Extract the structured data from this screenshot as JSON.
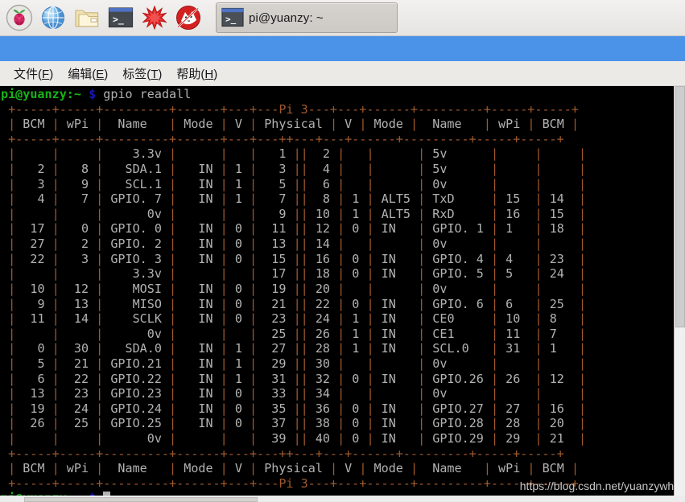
{
  "taskbar": {
    "icons": [
      {
        "name": "raspberry-menu-icon",
        "label": "Raspberry Pi Menu"
      },
      {
        "name": "globe-browser-icon",
        "label": "Web Browser"
      },
      {
        "name": "file-manager-icon",
        "label": "File Manager"
      },
      {
        "name": "terminal-icon",
        "label": "Terminal"
      },
      {
        "name": "mathematica-icon",
        "label": "Mathematica"
      },
      {
        "name": "wolfram-icon",
        "label": "Wolfram"
      }
    ],
    "task_button_label": "pi@yuanzy: ~"
  },
  "window": {
    "title": "pi@yuanzy: ~"
  },
  "menubar": {
    "items": [
      {
        "text": "文件",
        "accel": "F"
      },
      {
        "text": "编辑",
        "accel": "E"
      },
      {
        "text": "标签",
        "accel": "T"
      },
      {
        "text": "帮助",
        "accel": "H"
      }
    ]
  },
  "terminal": {
    "prompt_user": "pi@yuanzy",
    "prompt_path": ":~",
    "prompt_symbol": "$",
    "command": "gpio readall",
    "watermark": "https://blog.csdn.net/yuanzywhu",
    "board": "Pi 3",
    "colors": {
      "background": "#000000",
      "foreground": "#b2b2b2",
      "green": "#18b218",
      "blue": "#1818b2",
      "border": "#a05a2c"
    },
    "border_line": "+-----+-----+---------+------+---+---Pi 3---+---+------+---------+-----+-----+",
    "separator_line": "+-----+-----+---------+------+---+---++---+---+------+---------+-----+-----+",
    "header_line": "| BCM | wPi |   Name  | Mode | V | Physical | V | Mode | Name    | wPi | BCM |",
    "columns": [
      "BCM",
      "wPi",
      "Name",
      "Mode",
      "V",
      "Physical",
      "V",
      "Mode",
      "Name",
      "wPi",
      "BCM"
    ],
    "rows": [
      {
        "bcm_l": "",
        "wpi_l": "",
        "name_l": "3.3v",
        "mode_l": "",
        "v_l": "",
        "phys_l": "1",
        "phys_r": "2",
        "v_r": "",
        "mode_r": "",
        "name_r": "5v",
        "wpi_r": "",
        "bcm_r": ""
      },
      {
        "bcm_l": "2",
        "wpi_l": "8",
        "name_l": "SDA.1",
        "mode_l": "IN",
        "v_l": "1",
        "phys_l": "3",
        "phys_r": "4",
        "v_r": "",
        "mode_r": "",
        "name_r": "5v",
        "wpi_r": "",
        "bcm_r": ""
      },
      {
        "bcm_l": "3",
        "wpi_l": "9",
        "name_l": "SCL.1",
        "mode_l": "IN",
        "v_l": "1",
        "phys_l": "5",
        "phys_r": "6",
        "v_r": "",
        "mode_r": "",
        "name_r": "0v",
        "wpi_r": "",
        "bcm_r": ""
      },
      {
        "bcm_l": "4",
        "wpi_l": "7",
        "name_l": "GPIO. 7",
        "mode_l": "IN",
        "v_l": "1",
        "phys_l": "7",
        "phys_r": "8",
        "v_r": "1",
        "mode_r": "ALT5",
        "name_r": "TxD",
        "wpi_r": "15",
        "bcm_r": "14"
      },
      {
        "bcm_l": "",
        "wpi_l": "",
        "name_l": "0v",
        "mode_l": "",
        "v_l": "",
        "phys_l": "9",
        "phys_r": "10",
        "v_r": "1",
        "mode_r": "ALT5",
        "name_r": "RxD",
        "wpi_r": "16",
        "bcm_r": "15"
      },
      {
        "bcm_l": "17",
        "wpi_l": "0",
        "name_l": "GPIO. 0",
        "mode_l": "IN",
        "v_l": "0",
        "phys_l": "11",
        "phys_r": "12",
        "v_r": "0",
        "mode_r": "IN",
        "name_r": "GPIO. 1",
        "wpi_r": "1",
        "bcm_r": "18"
      },
      {
        "bcm_l": "27",
        "wpi_l": "2",
        "name_l": "GPIO. 2",
        "mode_l": "IN",
        "v_l": "0",
        "phys_l": "13",
        "phys_r": "14",
        "v_r": "",
        "mode_r": "",
        "name_r": "0v",
        "wpi_r": "",
        "bcm_r": ""
      },
      {
        "bcm_l": "22",
        "wpi_l": "3",
        "name_l": "GPIO. 3",
        "mode_l": "IN",
        "v_l": "0",
        "phys_l": "15",
        "phys_r": "16",
        "v_r": "0",
        "mode_r": "IN",
        "name_r": "GPIO. 4",
        "wpi_r": "4",
        "bcm_r": "23"
      },
      {
        "bcm_l": "",
        "wpi_l": "",
        "name_l": "3.3v",
        "mode_l": "",
        "v_l": "",
        "phys_l": "17",
        "phys_r": "18",
        "v_r": "0",
        "mode_r": "IN",
        "name_r": "GPIO. 5",
        "wpi_r": "5",
        "bcm_r": "24"
      },
      {
        "bcm_l": "10",
        "wpi_l": "12",
        "name_l": "MOSI",
        "mode_l": "IN",
        "v_l": "0",
        "phys_l": "19",
        "phys_r": "20",
        "v_r": "",
        "mode_r": "",
        "name_r": "0v",
        "wpi_r": "",
        "bcm_r": ""
      },
      {
        "bcm_l": "9",
        "wpi_l": "13",
        "name_l": "MISO",
        "mode_l": "IN",
        "v_l": "0",
        "phys_l": "21",
        "phys_r": "22",
        "v_r": "0",
        "mode_r": "IN",
        "name_r": "GPIO. 6",
        "wpi_r": "6",
        "bcm_r": "25"
      },
      {
        "bcm_l": "11",
        "wpi_l": "14",
        "name_l": "SCLK",
        "mode_l": "IN",
        "v_l": "0",
        "phys_l": "23",
        "phys_r": "24",
        "v_r": "1",
        "mode_r": "IN",
        "name_r": "CE0",
        "wpi_r": "10",
        "bcm_r": "8"
      },
      {
        "bcm_l": "",
        "wpi_l": "",
        "name_l": "0v",
        "mode_l": "",
        "v_l": "",
        "phys_l": "25",
        "phys_r": "26",
        "v_r": "1",
        "mode_r": "IN",
        "name_r": "CE1",
        "wpi_r": "11",
        "bcm_r": "7"
      },
      {
        "bcm_l": "0",
        "wpi_l": "30",
        "name_l": "SDA.0",
        "mode_l": "IN",
        "v_l": "1",
        "phys_l": "27",
        "phys_r": "28",
        "v_r": "1",
        "mode_r": "IN",
        "name_r": "SCL.0",
        "wpi_r": "31",
        "bcm_r": "1"
      },
      {
        "bcm_l": "5",
        "wpi_l": "21",
        "name_l": "GPIO.21",
        "mode_l": "IN",
        "v_l": "1",
        "phys_l": "29",
        "phys_r": "30",
        "v_r": "",
        "mode_r": "",
        "name_r": "0v",
        "wpi_r": "",
        "bcm_r": ""
      },
      {
        "bcm_l": "6",
        "wpi_l": "22",
        "name_l": "GPIO.22",
        "mode_l": "IN",
        "v_l": "1",
        "phys_l": "31",
        "phys_r": "32",
        "v_r": "0",
        "mode_r": "IN",
        "name_r": "GPIO.26",
        "wpi_r": "26",
        "bcm_r": "12"
      },
      {
        "bcm_l": "13",
        "wpi_l": "23",
        "name_l": "GPIO.23",
        "mode_l": "IN",
        "v_l": "0",
        "phys_l": "33",
        "phys_r": "34",
        "v_r": "",
        "mode_r": "",
        "name_r": "0v",
        "wpi_r": "",
        "bcm_r": ""
      },
      {
        "bcm_l": "19",
        "wpi_l": "24",
        "name_l": "GPIO.24",
        "mode_l": "IN",
        "v_l": "0",
        "phys_l": "35",
        "phys_r": "36",
        "v_r": "0",
        "mode_r": "IN",
        "name_r": "GPIO.27",
        "wpi_r": "27",
        "bcm_r": "16"
      },
      {
        "bcm_l": "26",
        "wpi_l": "25",
        "name_l": "GPIO.25",
        "mode_l": "IN",
        "v_l": "0",
        "phys_l": "37",
        "phys_r": "38",
        "v_r": "0",
        "mode_r": "IN",
        "name_r": "GPIO.28",
        "wpi_r": "28",
        "bcm_r": "20"
      },
      {
        "bcm_l": "",
        "wpi_l": "",
        "name_l": "0v",
        "mode_l": "",
        "v_l": "",
        "phys_l": "39",
        "phys_r": "40",
        "v_r": "0",
        "mode_r": "IN",
        "name_r": "GPIO.29",
        "wpi_r": "29",
        "bcm_r": "21"
      }
    ]
  }
}
